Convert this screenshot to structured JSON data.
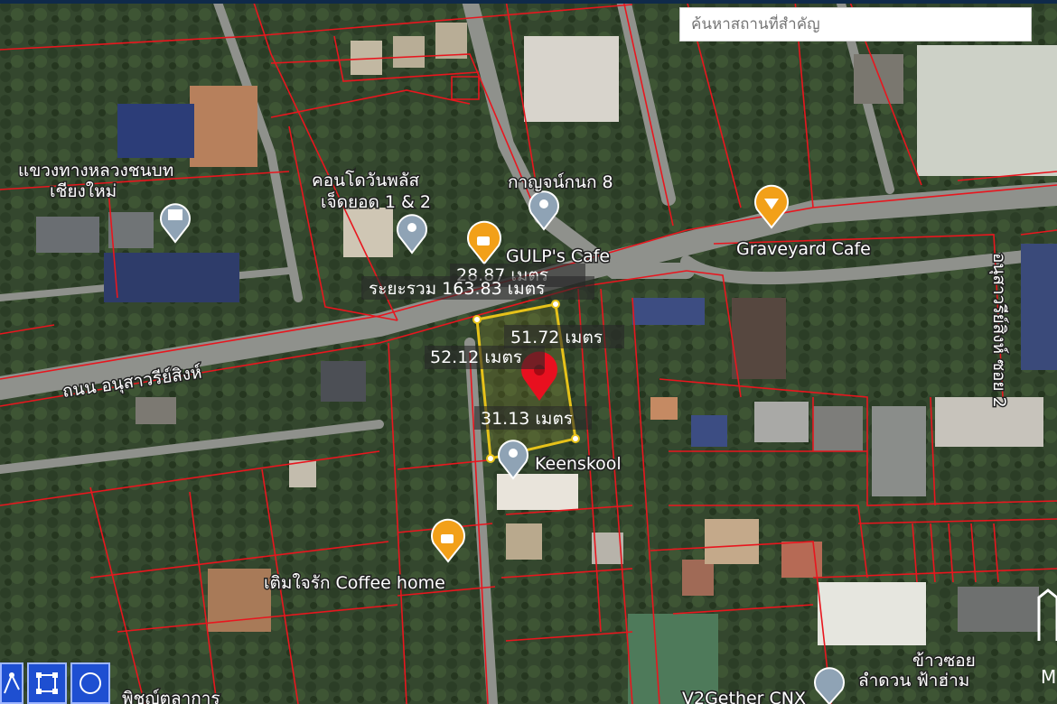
{
  "search": {
    "placeholder": "ค้นหาสถานที่สำคัญ"
  },
  "measure": {
    "total": "ระยะรวม 163.83 เมตร",
    "top": "28.87 เมตร",
    "right": "51.72 เมตร",
    "left": "52.12 เมตร",
    "bottom": "31.13 เมตร"
  },
  "places": {
    "office": [
      "แขวงทางหลวงชนบท",
      "เชียงใหม่"
    ],
    "condo": [
      "คอนโดวันพลัส",
      "เจ็ดยอด 1 & 2"
    ],
    "kanjanakanok": "กาญจน์กนก 8",
    "gulp": "GULP's Cafe",
    "graveyard": "Graveyard Cafe",
    "road_main": "ถนน อนุสาวรีย์สิงห์",
    "road_soi": "อนุสาวรีย์สิงห์ ซอย 2",
    "keenskool": "Keenskool",
    "coffeehome": "เติมใจรัก Coffee home",
    "khaosoi": [
      "ข้าวซอย",
      "ลำดวน ฟ้าฮ่าม"
    ],
    "v2gether": "V2Gether CNX",
    "bottom_left": "พิชญ์ตุลาการ"
  },
  "brand": {
    "letter": "M"
  },
  "colors": {
    "parcel": "#e8161e",
    "measure": "#e6c21a",
    "pin": "#e8101f",
    "tool": "#1e4fd1"
  },
  "icons": {
    "poi": "location-pin-icon",
    "cafe": "coffee-cup-icon",
    "gov": "building-icon"
  }
}
